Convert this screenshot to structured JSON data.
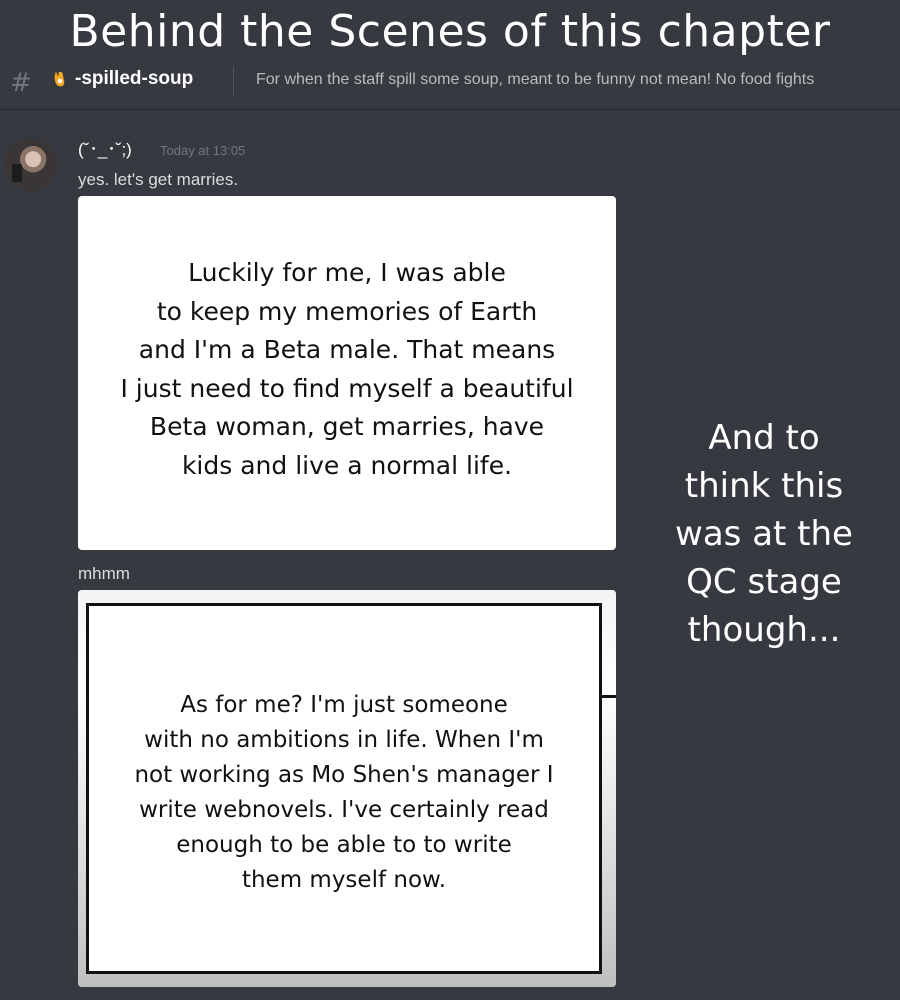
{
  "title": "Behind the Scenes of this chapter",
  "channel": {
    "hash_icon": "hashtag-icon",
    "emoji_icon": "soup-icon",
    "name": "-spilled-soup",
    "topic": "For when the staff spill some soup, meant to be funny not mean! No food fights"
  },
  "message": {
    "username": "(˘･_･˘;)",
    "timestamp": "Today at 13:05",
    "line1": "yes. let's get marries.",
    "attachment1_text": "Luckily for me, I was able\nto keep my memories of Earth\nand I'm a Beta male. That means\nI just need to find myself a beautiful\nBeta woman, get marries, have\nkids and live a normal life.",
    "line2": "mhmm",
    "attachment2_text": "As for me? I'm just someone\nwith no ambitions in life. When I'm\nnot working as Mo Shen's manager I\nwrite webnovels. I've certainly read\nenough to be able to to write\nthem myself now."
  },
  "side_note": "And to\nthink this\nwas at the\nQC stage\nthough...",
  "colors": {
    "background": "#36393f",
    "username": "#ffffff",
    "timestamp": "#72767d",
    "topic": "#b9bbbe"
  }
}
